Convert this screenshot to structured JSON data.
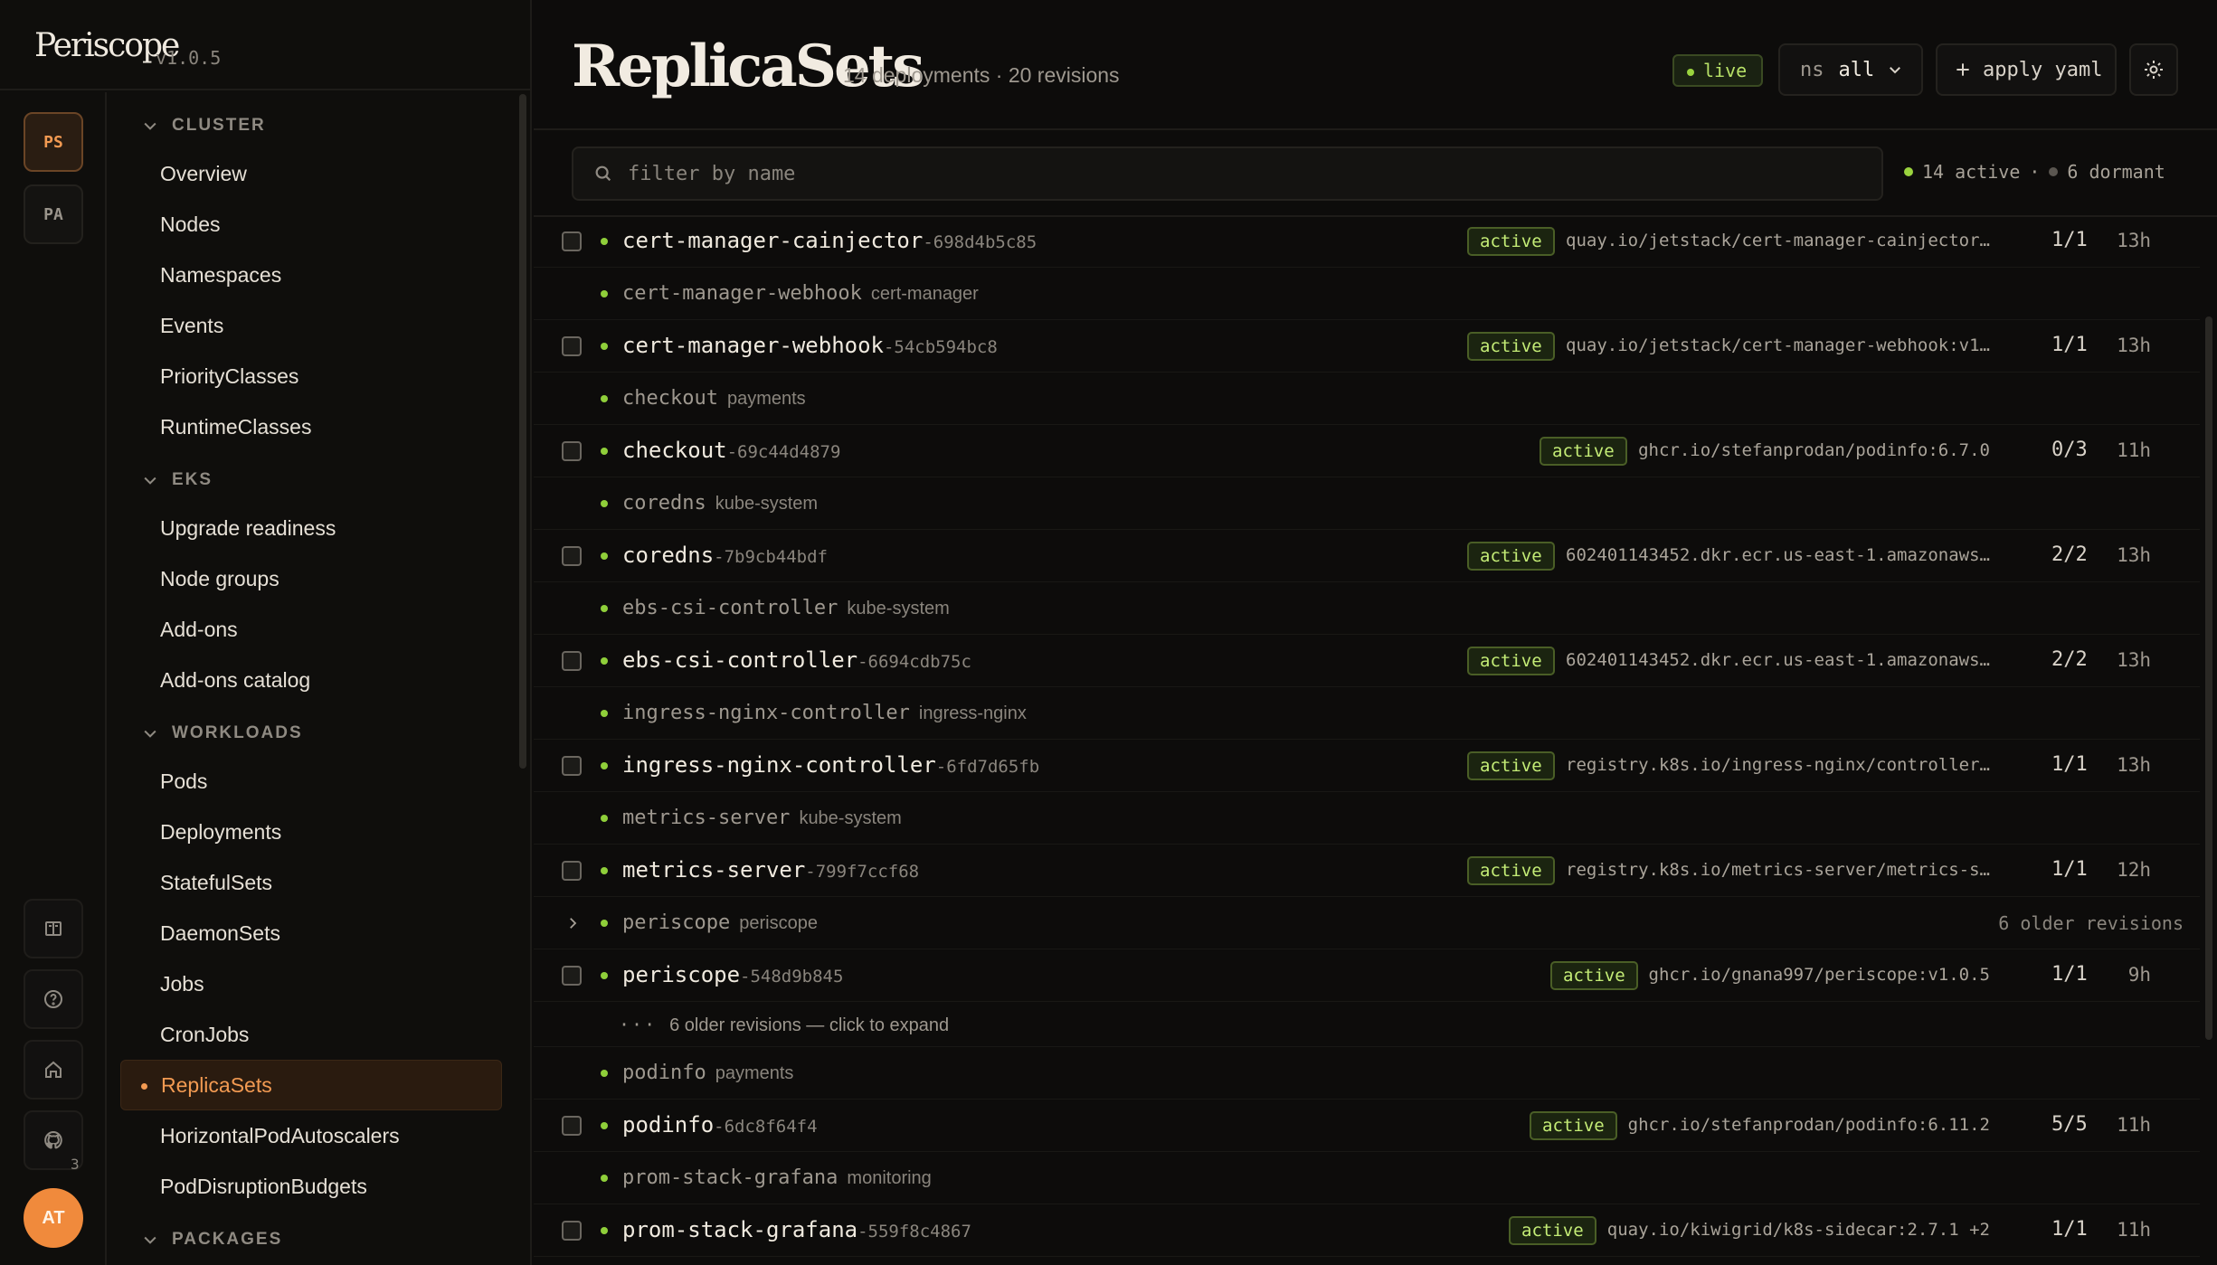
{
  "brand": {
    "name": "Periscope",
    "version": "v1.0.5"
  },
  "workspaces": [
    "PS",
    "PA"
  ],
  "rail": {
    "badge": "3",
    "avatar": "AT"
  },
  "nav": {
    "groups": [
      {
        "label": "CLUSTER",
        "items": [
          "Overview",
          "Nodes",
          "Namespaces",
          "Events",
          "PriorityClasses",
          "RuntimeClasses"
        ]
      },
      {
        "label": "EKS",
        "items": [
          "Upgrade readiness",
          "Node groups",
          "Add-ons",
          "Add-ons catalog"
        ]
      },
      {
        "label": "WORKLOADS",
        "items": [
          "Pods",
          "Deployments",
          "StatefulSets",
          "DaemonSets",
          "Jobs",
          "CronJobs",
          "ReplicaSets",
          "HorizontalPodAutoscalers",
          "PodDisruptionBudgets"
        ]
      },
      {
        "label": "PACKAGES",
        "items": []
      }
    ],
    "active": "ReplicaSets"
  },
  "header": {
    "title": "ReplicaSets",
    "subtitle": "14 deployments · 20 revisions",
    "live": "live",
    "ns_label": "ns",
    "ns_value": "all",
    "apply": "apply yaml"
  },
  "filter": {
    "placeholder": "filter by name"
  },
  "counts": {
    "active": "14 active",
    "sep": "·",
    "dormant": "6 dormant"
  },
  "rows": [
    {
      "kind": "rs",
      "name": "cert-manager-cainjector",
      "hash": "-698d4b5c85",
      "status": "active",
      "image": "quay.io/jetstack/cert-manager-cainjector…",
      "ready": "1/1",
      "age": "13h"
    },
    {
      "kind": "group",
      "name": "cert-manager-webhook",
      "ns": "cert-manager"
    },
    {
      "kind": "rs",
      "name": "cert-manager-webhook",
      "hash": "-54cb594bc8",
      "status": "active",
      "image": "quay.io/jetstack/cert-manager-webhook:v1…",
      "ready": "1/1",
      "age": "13h"
    },
    {
      "kind": "group",
      "name": "checkout",
      "ns": "payments"
    },
    {
      "kind": "rs",
      "name": "checkout",
      "hash": "-69c44d4879",
      "status": "active",
      "image": "ghcr.io/stefanprodan/podinfo:6.7.0",
      "ready": "0/3",
      "age": "11h"
    },
    {
      "kind": "group",
      "name": "coredns",
      "ns": "kube-system"
    },
    {
      "kind": "rs",
      "name": "coredns",
      "hash": "-7b9cb44bdf",
      "status": "active",
      "image": "602401143452.dkr.ecr.us-east-1.amazonaws…",
      "ready": "2/2",
      "age": "13h"
    },
    {
      "kind": "group",
      "name": "ebs-csi-controller",
      "ns": "kube-system"
    },
    {
      "kind": "rs",
      "name": "ebs-csi-controller",
      "hash": "-6694cdb75c",
      "status": "active",
      "image": "602401143452.dkr.ecr.us-east-1.amazonaws…",
      "ready": "2/2",
      "age": "13h"
    },
    {
      "kind": "group",
      "name": "ingress-nginx-controller",
      "ns": "ingress-nginx"
    },
    {
      "kind": "rs",
      "name": "ingress-nginx-controller",
      "hash": "-6fd7d65fb",
      "status": "active",
      "image": "registry.k8s.io/ingress-nginx/controller…",
      "ready": "1/1",
      "age": "13h"
    },
    {
      "kind": "group",
      "name": "metrics-server",
      "ns": "kube-system"
    },
    {
      "kind": "rs",
      "name": "metrics-server",
      "hash": "-799f7ccf68",
      "status": "active",
      "image": "registry.k8s.io/metrics-server/metrics-s…",
      "ready": "1/1",
      "age": "12h"
    },
    {
      "kind": "group",
      "name": "periscope",
      "ns": "periscope",
      "expandable": true,
      "older": "6 older revisions"
    },
    {
      "kind": "rs",
      "name": "periscope",
      "hash": "-548d9b845",
      "status": "active",
      "image": "ghcr.io/gnana997/periscope:v1.0.5",
      "ready": "1/1",
      "age": "9h"
    },
    {
      "kind": "hint",
      "text": "6 older revisions — click to expand",
      "dots": "···"
    },
    {
      "kind": "group",
      "name": "podinfo",
      "ns": "payments"
    },
    {
      "kind": "rs",
      "name": "podinfo",
      "hash": "-6dc8f64f4",
      "status": "active",
      "image": "ghcr.io/stefanprodan/podinfo:6.11.2",
      "ready": "5/5",
      "age": "11h"
    },
    {
      "kind": "group",
      "name": "prom-stack-grafana",
      "ns": "monitoring"
    },
    {
      "kind": "rs",
      "name": "prom-stack-grafana",
      "hash": "-559f8c4867",
      "status": "active",
      "image": "quay.io/kiwigrid/k8s-sidecar:2.7.1 +2",
      "ready": "1/1",
      "age": "11h"
    }
  ],
  "colors": {
    "accent": "#f29a52",
    "active": "#9ad33e",
    "bg": "#0d0c0b"
  }
}
